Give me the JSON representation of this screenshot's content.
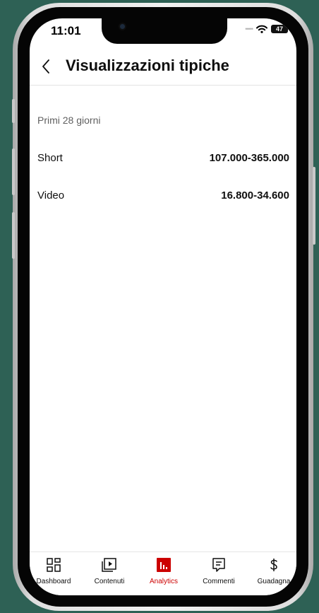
{
  "status_bar": {
    "time": "11:01",
    "battery": "47"
  },
  "header": {
    "title": "Visualizzazioni tipiche"
  },
  "period": "Primi 28 giorni",
  "metrics": [
    {
      "label": "Short",
      "value": "107.000-365.000"
    },
    {
      "label": "Video",
      "value": "16.800-34.600"
    }
  ],
  "bottom_nav": [
    {
      "label": "Dashboard",
      "icon": "dashboard-icon",
      "active": false
    },
    {
      "label": "Contenuti",
      "icon": "content-icon",
      "active": false
    },
    {
      "label": "Analytics",
      "icon": "analytics-icon",
      "active": true
    },
    {
      "label": "Commenti",
      "icon": "comments-icon",
      "active": false
    },
    {
      "label": "Guadagna",
      "icon": "earn-icon",
      "active": false
    }
  ],
  "colors": {
    "accent": "#cc0000",
    "text_primary": "#0f0f0f",
    "text_secondary": "#606060",
    "background": "#2e6155"
  }
}
